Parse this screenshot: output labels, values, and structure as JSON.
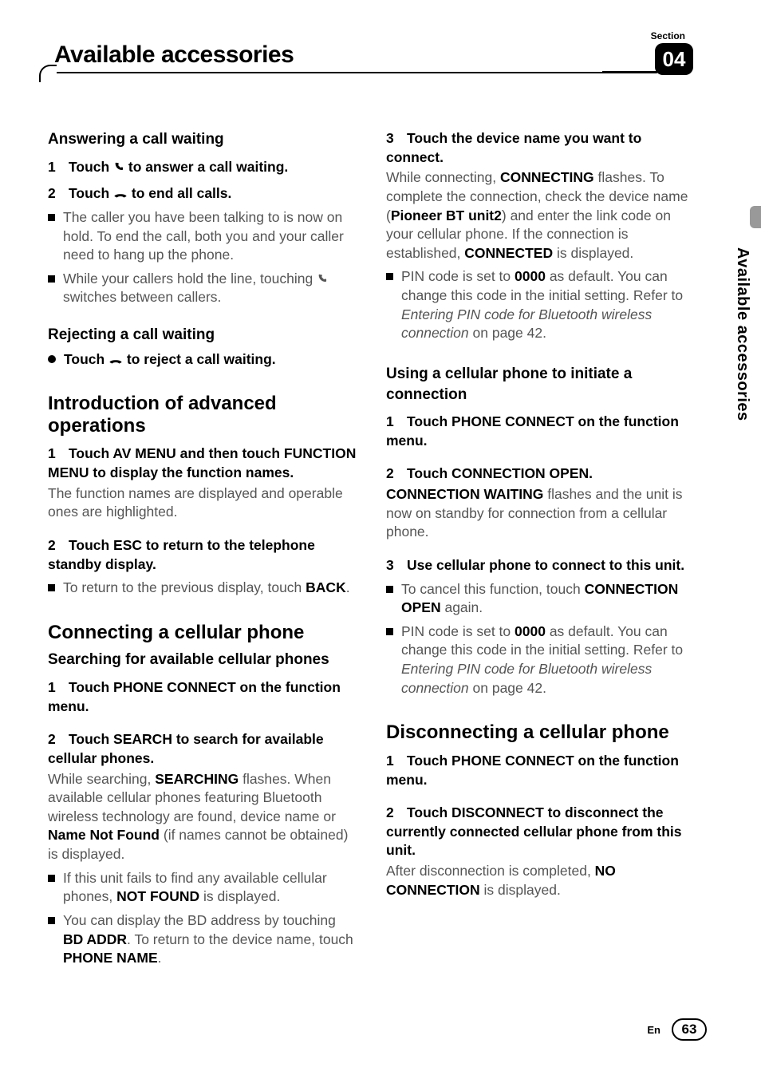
{
  "header": {
    "title": "Available accessories",
    "section_label": "Section",
    "section_number": "04"
  },
  "side_tab": "Available accessories",
  "left": {
    "answering": {
      "heading": "Answering a call waiting",
      "s1_pre": "Touch ",
      "s1_post": " to answer a call waiting.",
      "s2_pre": "Touch ",
      "s2_post": " to end all calls.",
      "b1": "The caller you have been talking to is now on hold. To end the call, both you and your caller need to hang up the phone.",
      "b2_pre": "While your callers hold the line, touching ",
      "b2_post": " switches between callers."
    },
    "rejecting": {
      "heading": "Rejecting a call waiting",
      "s1_pre": "Touch ",
      "s1_post": " to reject a call waiting."
    },
    "intro": {
      "heading": "Introduction of advanced operations",
      "s1": "Touch AV MENU and then touch FUNCTION MENU to display the function names.",
      "body1": "The function names are displayed and operable ones are highlighted.",
      "s2": "Touch ESC to return to the telephone standby display.",
      "b1_pre": "To return to the previous display, touch ",
      "b1_bold": "BACK",
      "b1_post": "."
    },
    "connect": {
      "heading": "Connecting a cellular phone",
      "sub1": "Searching for available cellular phones",
      "s1": "Touch PHONE CONNECT on the function menu.",
      "s2": "Touch SEARCH to search for available cellular phones.",
      "body_pre": "While searching, ",
      "body_b1": "SEARCHING",
      "body_mid": " flashes. When available cellular phones featuring Bluetooth wireless technology are found, device name or ",
      "body_b2": "Name Not Found",
      "body_post": " (if names cannot be obtained) is displayed.",
      "bl1_pre": "If this unit fails to find any available cellular phones, ",
      "bl1_bold": "NOT FOUND",
      "bl1_post": " is displayed.",
      "bl2_pre": "You can display the BD address by touching ",
      "bl2_b1": "BD ADDR",
      "bl2_mid": ". To return to the device name, touch ",
      "bl2_b2": "PHONE NAME",
      "bl2_post": "."
    }
  },
  "right": {
    "connect3": {
      "s3": "Touch the device name you want to connect.",
      "body_pre": "While connecting, ",
      "body_b1": "CONNECTING",
      "body_mid1": " flashes. To complete the connection, check the device name (",
      "body_b2": "Pioneer BT unit2",
      "body_mid2": ") and enter the link code on your cellular phone. If the connection is established, ",
      "body_b3": "CONNECTED",
      "body_post": " is displayed.",
      "bl_pre": "PIN code is set to ",
      "bl_bold": "0000",
      "bl_mid": " as default. You can change this code in the initial setting. Refer to ",
      "bl_ital": "Entering PIN code for Bluetooth wireless connection",
      "bl_post": " on page 42."
    },
    "using": {
      "heading": "Using a cellular phone to initiate a connection",
      "s1": "Touch PHONE CONNECT on the function menu.",
      "s2": "Touch CONNECTION OPEN.",
      "body2_b": "CONNECTION WAITING",
      "body2_post": " flashes and the unit is now on standby for connection from a cellular phone.",
      "s3": "Use cellular phone to connect to this unit.",
      "bl1_pre": "To cancel this function, touch ",
      "bl1_bold": "CONNECTION OPEN",
      "bl1_post": " again.",
      "bl2_pre": "PIN code is set to ",
      "bl2_bold": "0000",
      "bl2_mid": " as default. You can change this code in the initial setting. Refer to ",
      "bl2_ital": "Entering PIN code for Bluetooth wireless connection",
      "bl2_post": " on page 42."
    },
    "disconnect": {
      "heading": "Disconnecting a cellular phone",
      "s1": "Touch PHONE CONNECT on the function menu.",
      "s2": "Touch DISCONNECT to disconnect the currently connected cellular phone from this unit.",
      "body_pre": "After disconnection is completed, ",
      "body_bold": "NO CONNECTION",
      "body_post": " is displayed."
    }
  },
  "footer": {
    "lang": "En",
    "page": "63"
  }
}
